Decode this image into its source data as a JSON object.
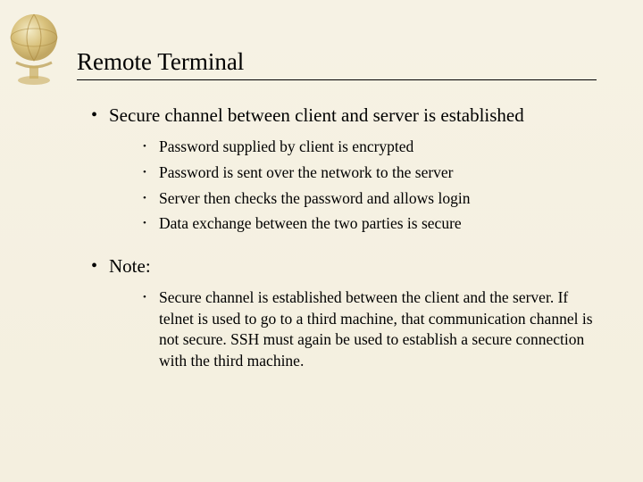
{
  "title": "Remote Terminal",
  "bullets": [
    {
      "text": "Secure channel between client and server is established",
      "sub": [
        "Password supplied by client is encrypted",
        "Password is sent over the network to the server",
        "Server then checks the password and allows login",
        "Data exchange between the two parties is secure"
      ]
    },
    {
      "text": "Note:",
      "sub": [
        "Secure channel is established between the client and the server. If telnet is used to go to a third machine, that communication channel is not secure. SSH must again be used to establish a secure connection with the third machine."
      ]
    }
  ]
}
